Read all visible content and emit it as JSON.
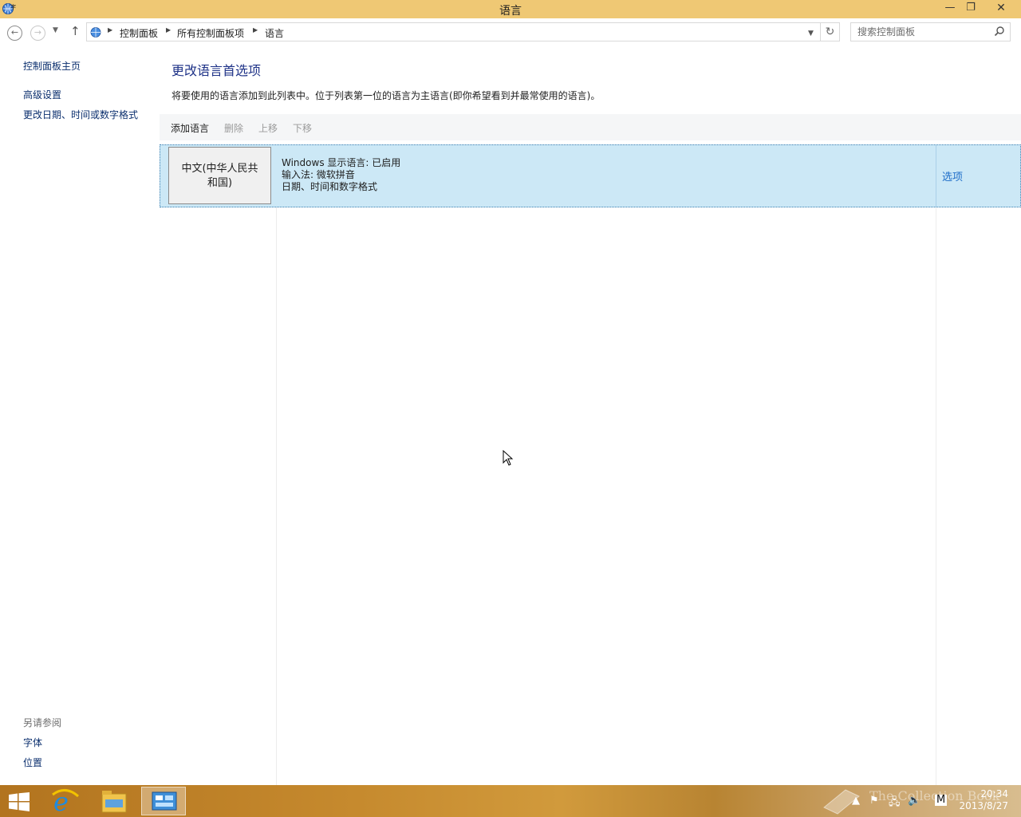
{
  "window": {
    "title": "语言",
    "minimize": "—",
    "maximize": "❐",
    "close": "✕"
  },
  "address": {
    "crumbs": [
      "控制面板",
      "所有控制面板项",
      "语言"
    ],
    "search_placeholder": "搜索控制面板"
  },
  "sidebar": {
    "home": "控制面板主页",
    "links": [
      "高级设置",
      "更改日期、时间或数字格式"
    ],
    "see_also_heading": "另请参阅",
    "see_also": [
      "字体",
      "位置"
    ]
  },
  "main": {
    "title": "更改语言首选项",
    "description": "将要使用的语言添加到此列表中。位于列表第一位的语言为主语言(即你希望看到并最常使用的语言)。",
    "toolbar": {
      "add": "添加语言",
      "remove": "删除",
      "move_up": "上移",
      "move_down": "下移"
    },
    "languages": [
      {
        "name_line1": "中文(中华人民共",
        "name_line2": "和国)",
        "display": "Windows 显示语言: 已启用",
        "input": "输入法: 微软拼音",
        "format": "日期、时间和数字格式",
        "options": "选项"
      }
    ]
  },
  "taskbar": {
    "time": "20:34",
    "date": "2013/8/27",
    "watermark": "The Collection Book",
    "ime": "M"
  },
  "colors": {
    "accent_link": "#1c6cc8",
    "selection": "#cce8f6",
    "titlebar": "#efc874"
  }
}
